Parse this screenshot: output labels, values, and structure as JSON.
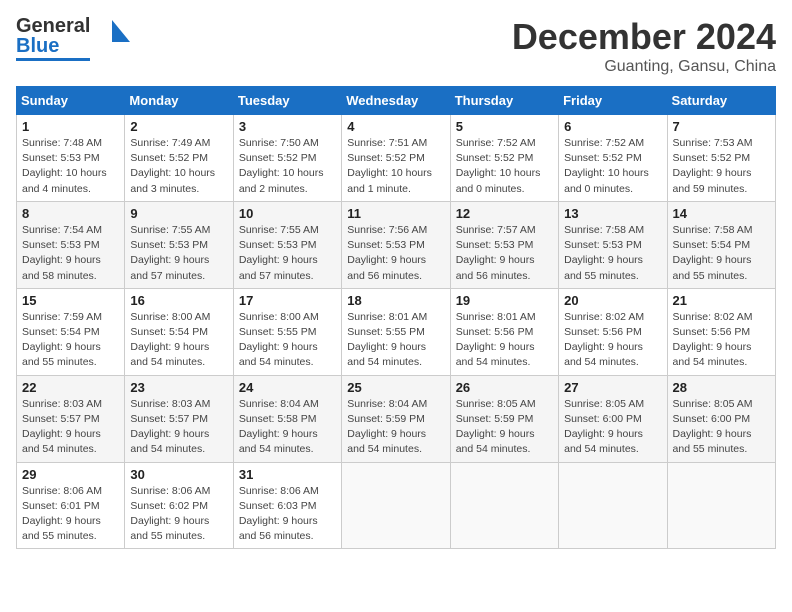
{
  "header": {
    "logo_general": "General",
    "logo_blue": "Blue",
    "title": "December 2024",
    "subtitle": "Guanting, Gansu, China"
  },
  "weekdays": [
    "Sunday",
    "Monday",
    "Tuesday",
    "Wednesday",
    "Thursday",
    "Friday",
    "Saturday"
  ],
  "weeks": [
    [
      {
        "day": "1",
        "sunrise": "7:48 AM",
        "sunset": "5:53 PM",
        "daylight": "10 hours and 4 minutes."
      },
      {
        "day": "2",
        "sunrise": "7:49 AM",
        "sunset": "5:52 PM",
        "daylight": "10 hours and 3 minutes."
      },
      {
        "day": "3",
        "sunrise": "7:50 AM",
        "sunset": "5:52 PM",
        "daylight": "10 hours and 2 minutes."
      },
      {
        "day": "4",
        "sunrise": "7:51 AM",
        "sunset": "5:52 PM",
        "daylight": "10 hours and 1 minute."
      },
      {
        "day": "5",
        "sunrise": "7:52 AM",
        "sunset": "5:52 PM",
        "daylight": "10 hours and 0 minutes."
      },
      {
        "day": "6",
        "sunrise": "7:52 AM",
        "sunset": "5:52 PM",
        "daylight": "10 hours and 0 minutes."
      },
      {
        "day": "7",
        "sunrise": "7:53 AM",
        "sunset": "5:52 PM",
        "daylight": "9 hours and 59 minutes."
      }
    ],
    [
      {
        "day": "8",
        "sunrise": "7:54 AM",
        "sunset": "5:53 PM",
        "daylight": "9 hours and 58 minutes."
      },
      {
        "day": "9",
        "sunrise": "7:55 AM",
        "sunset": "5:53 PM",
        "daylight": "9 hours and 57 minutes."
      },
      {
        "day": "10",
        "sunrise": "7:55 AM",
        "sunset": "5:53 PM",
        "daylight": "9 hours and 57 minutes."
      },
      {
        "day": "11",
        "sunrise": "7:56 AM",
        "sunset": "5:53 PM",
        "daylight": "9 hours and 56 minutes."
      },
      {
        "day": "12",
        "sunrise": "7:57 AM",
        "sunset": "5:53 PM",
        "daylight": "9 hours and 56 minutes."
      },
      {
        "day": "13",
        "sunrise": "7:58 AM",
        "sunset": "5:53 PM",
        "daylight": "9 hours and 55 minutes."
      },
      {
        "day": "14",
        "sunrise": "7:58 AM",
        "sunset": "5:54 PM",
        "daylight": "9 hours and 55 minutes."
      }
    ],
    [
      {
        "day": "15",
        "sunrise": "7:59 AM",
        "sunset": "5:54 PM",
        "daylight": "9 hours and 55 minutes."
      },
      {
        "day": "16",
        "sunrise": "8:00 AM",
        "sunset": "5:54 PM",
        "daylight": "9 hours and 54 minutes."
      },
      {
        "day": "17",
        "sunrise": "8:00 AM",
        "sunset": "5:55 PM",
        "daylight": "9 hours and 54 minutes."
      },
      {
        "day": "18",
        "sunrise": "8:01 AM",
        "sunset": "5:55 PM",
        "daylight": "9 hours and 54 minutes."
      },
      {
        "day": "19",
        "sunrise": "8:01 AM",
        "sunset": "5:56 PM",
        "daylight": "9 hours and 54 minutes."
      },
      {
        "day": "20",
        "sunrise": "8:02 AM",
        "sunset": "5:56 PM",
        "daylight": "9 hours and 54 minutes."
      },
      {
        "day": "21",
        "sunrise": "8:02 AM",
        "sunset": "5:56 PM",
        "daylight": "9 hours and 54 minutes."
      }
    ],
    [
      {
        "day": "22",
        "sunrise": "8:03 AM",
        "sunset": "5:57 PM",
        "daylight": "9 hours and 54 minutes."
      },
      {
        "day": "23",
        "sunrise": "8:03 AM",
        "sunset": "5:57 PM",
        "daylight": "9 hours and 54 minutes."
      },
      {
        "day": "24",
        "sunrise": "8:04 AM",
        "sunset": "5:58 PM",
        "daylight": "9 hours and 54 minutes."
      },
      {
        "day": "25",
        "sunrise": "8:04 AM",
        "sunset": "5:59 PM",
        "daylight": "9 hours and 54 minutes."
      },
      {
        "day": "26",
        "sunrise": "8:05 AM",
        "sunset": "5:59 PM",
        "daylight": "9 hours and 54 minutes."
      },
      {
        "day": "27",
        "sunrise": "8:05 AM",
        "sunset": "6:00 PM",
        "daylight": "9 hours and 54 minutes."
      },
      {
        "day": "28",
        "sunrise": "8:05 AM",
        "sunset": "6:00 PM",
        "daylight": "9 hours and 55 minutes."
      }
    ],
    [
      {
        "day": "29",
        "sunrise": "8:06 AM",
        "sunset": "6:01 PM",
        "daylight": "9 hours and 55 minutes."
      },
      {
        "day": "30",
        "sunrise": "8:06 AM",
        "sunset": "6:02 PM",
        "daylight": "9 hours and 55 minutes."
      },
      {
        "day": "31",
        "sunrise": "8:06 AM",
        "sunset": "6:03 PM",
        "daylight": "9 hours and 56 minutes."
      },
      null,
      null,
      null,
      null
    ]
  ],
  "labels": {
    "sunrise": "Sunrise:",
    "sunset": "Sunset:",
    "daylight": "Daylight hours"
  }
}
